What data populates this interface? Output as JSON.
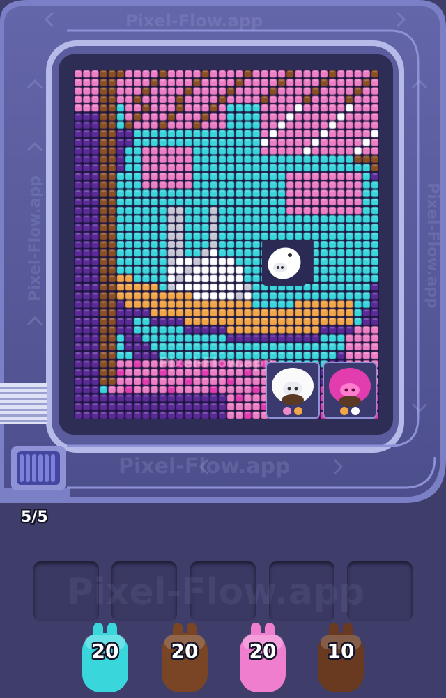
{
  "watermark": "Pixel-Flow.app",
  "conveyor": {
    "counter": "5/5"
  },
  "colors": {
    "background": "#3f3e6b",
    "track": "#5e5fa0",
    "track_light": "#b9bdf0",
    "cyan": "#39d7dc",
    "pink": "#ef7fc4",
    "magenta": "#e23cae",
    "purple": "#5b2a97",
    "brown": "#8a5024",
    "orange": "#f2a646",
    "white": "#ffffff",
    "grey": "#c8c8d4"
  },
  "board_pigs": [
    {
      "name": "white",
      "color": "#ffffff",
      "count": ""
    },
    {
      "name": "white",
      "color": "#ffffff",
      "count": ""
    },
    {
      "name": "magenta",
      "color": "#e23cae",
      "count": ""
    }
  ],
  "queue": [
    {
      "color_name": "cyan",
      "color": "#39d7dc",
      "count": "20"
    },
    {
      "color_name": "brown",
      "color": "#7a4524",
      "count": "20"
    },
    {
      "color_name": "pink",
      "color": "#f07ecf",
      "count": "20"
    },
    {
      "color_name": "brown",
      "color": "#6a3a20",
      "count": "10"
    }
  ],
  "slots": [
    "",
    "",
    "",
    "",
    ""
  ]
}
